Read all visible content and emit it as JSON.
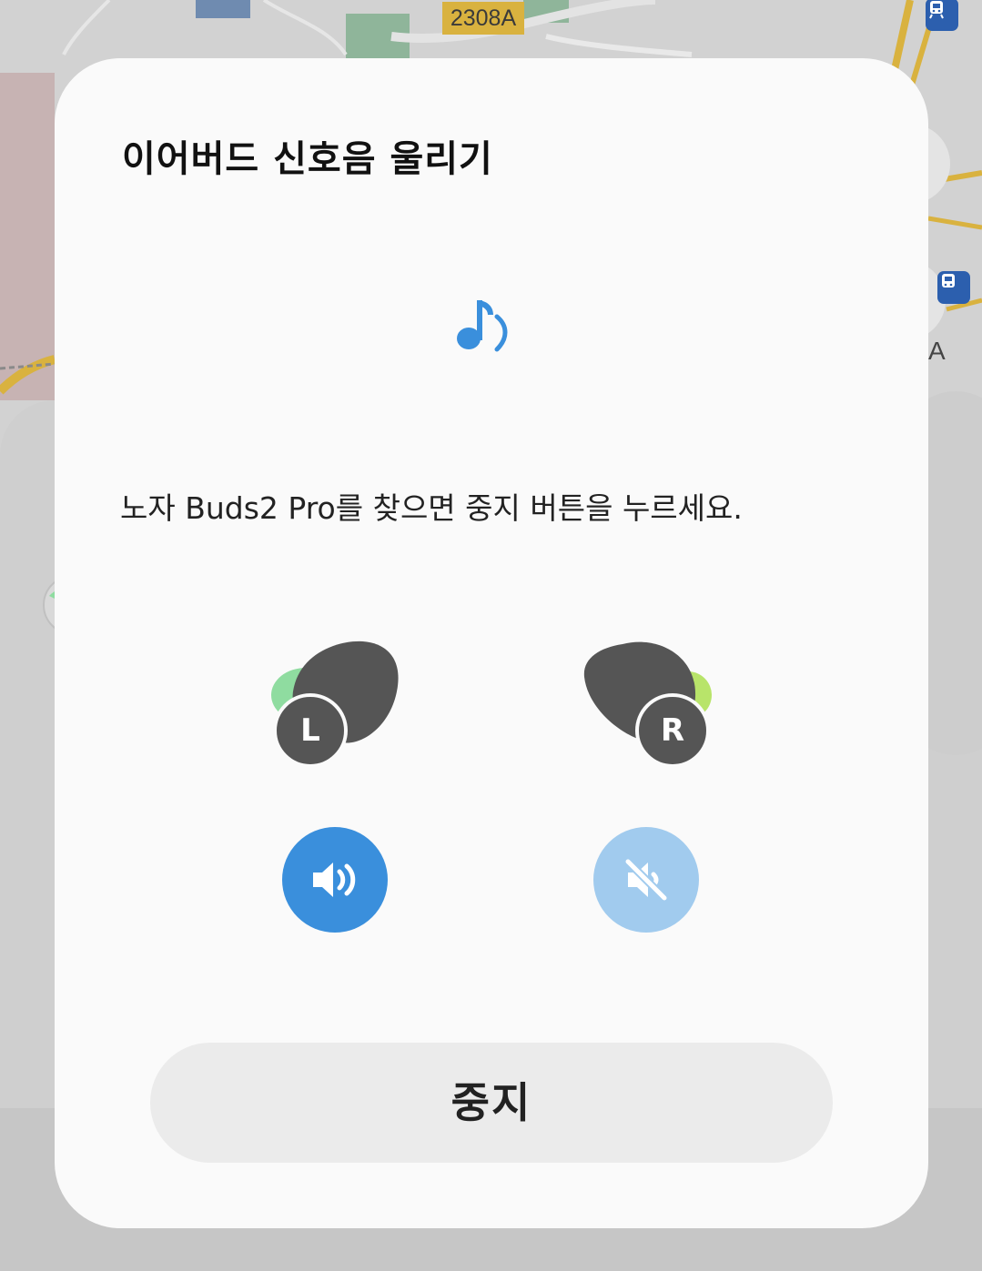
{
  "map": {
    "road_label": "2308A",
    "edge_label": "A",
    "icons": [
      "train-icon",
      "bus-icon"
    ]
  },
  "dialog": {
    "title": "이어버드 신호음 울리기",
    "icon": "music-note-ringing-icon",
    "message": "노자 Buds2 Pro를 찾으면 중지 버튼을 누르세요.",
    "left_bud": {
      "label": "L",
      "sound_state": "on",
      "icon": "volume-on-icon"
    },
    "right_bud": {
      "label": "R",
      "sound_state": "muted",
      "icon": "volume-muted-icon"
    },
    "stop_label": "중지"
  },
  "colors": {
    "accent": "#3a8fdc",
    "accent_disabled": "#a1cbee",
    "bud_body": "#555555",
    "left_bud_glow": "#8fdca0",
    "right_bud_glow": "#b8e46a",
    "dialog_bg": "#fafafa",
    "stop_button_bg": "#ebebeb"
  }
}
